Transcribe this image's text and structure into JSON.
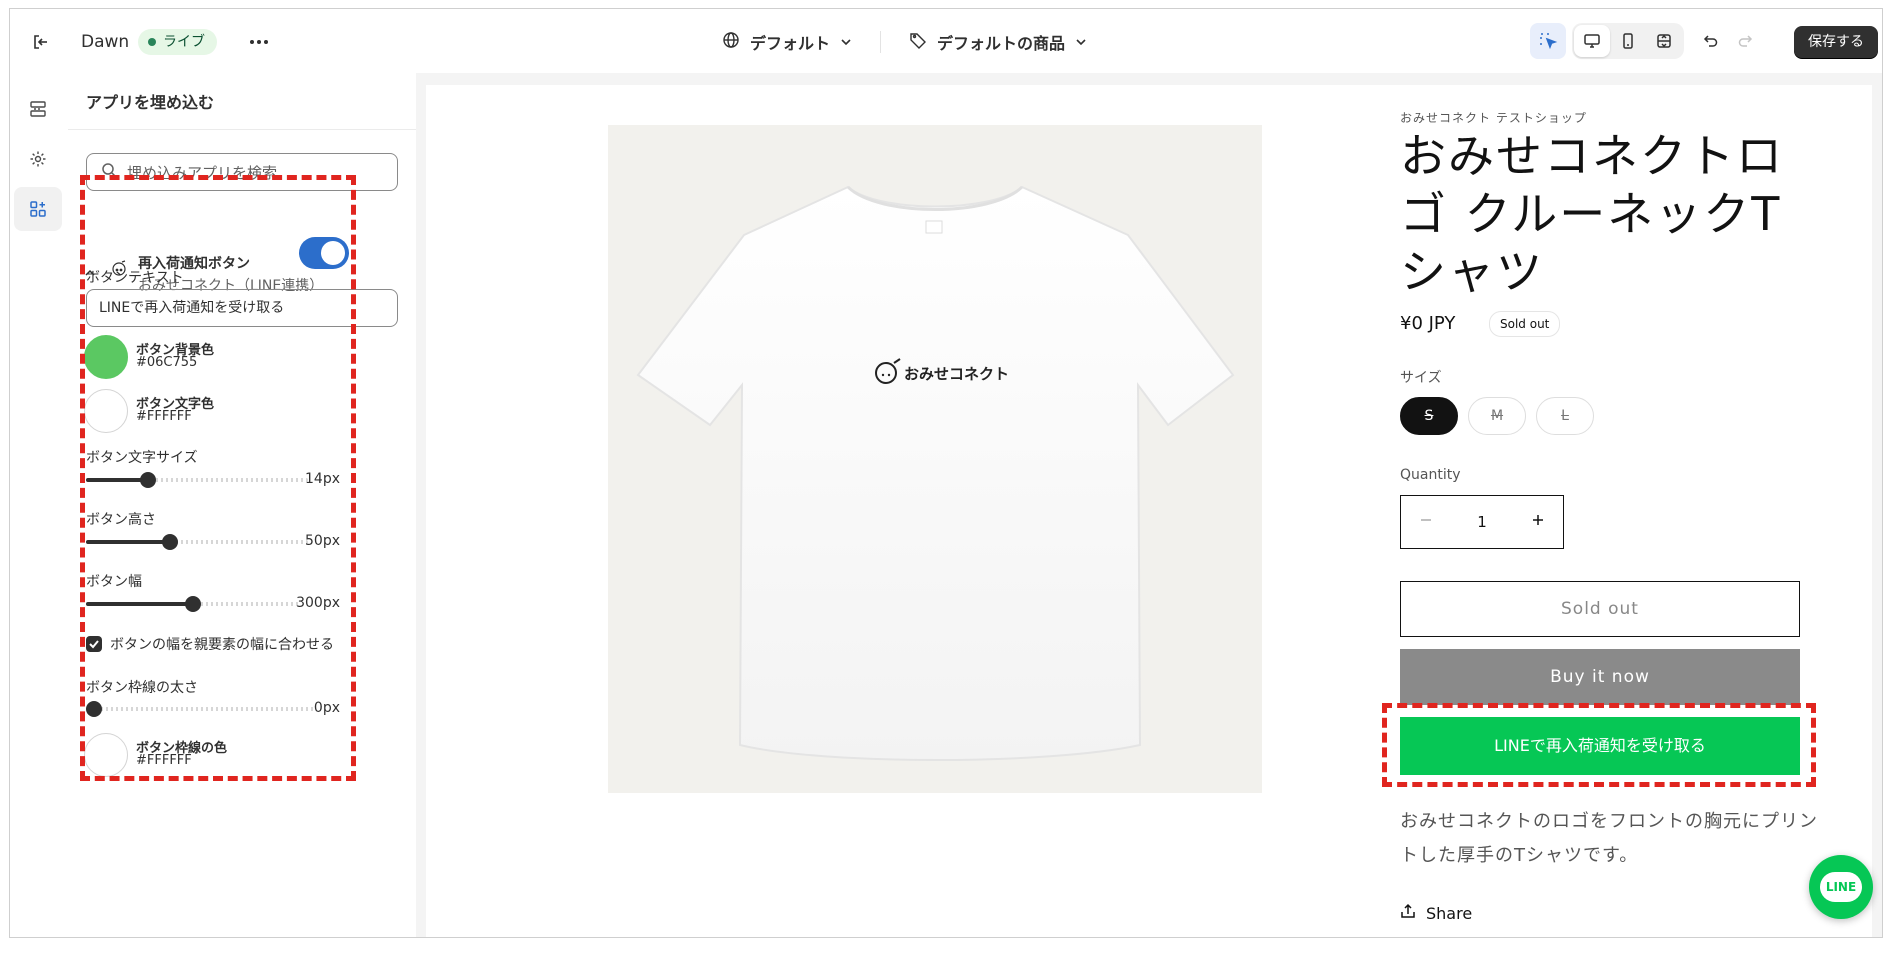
{
  "topbar": {
    "theme_name": "Dawn",
    "status_badge": "ライブ",
    "template_selector": "デフォルト",
    "product_selector": "デフォルトの商品",
    "save_label": "保存する"
  },
  "panel": {
    "title": "アプリを埋め込む",
    "search_placeholder": "埋め込みアプリを検索",
    "app": {
      "name": "再入荷通知ボタン",
      "provider": "おみせコネクト（LINE連携）",
      "enabled": true
    },
    "button_text_label": "ボタンテキスト",
    "button_text_value": "LINEで再入荷通知を受け取る",
    "bg_color": {
      "label": "ボタン背景色",
      "value": "#06C755"
    },
    "text_color": {
      "label": "ボタン文字色",
      "value": "#FFFFFF"
    },
    "font_size": {
      "label": "ボタン文字サイズ",
      "value": "14px",
      "level": 0.28
    },
    "height": {
      "label": "ボタン高さ",
      "value": "50px",
      "level": 0.38
    },
    "width": {
      "label": "ボタン幅",
      "value": "300px",
      "level": 0.5
    },
    "fit_parent_label": "ボタンの幅を親要素の幅に合わせる",
    "fit_parent_checked": true,
    "border_width": {
      "label": "ボタン枠線の太さ",
      "value": "0px",
      "level": 0
    },
    "border_color": {
      "label": "ボタン枠線の色",
      "value": "#FFFFFF"
    }
  },
  "product": {
    "vendor": "おみせコネクト テストショップ",
    "title": "おみせコネクトロゴ クルーネックTシャツ",
    "image_logo_text": "おみせコネクト",
    "price": "¥0 JPY",
    "sold_out_badge": "Sold out",
    "size_label": "サイズ",
    "sizes": [
      "S",
      "M",
      "L"
    ],
    "quantity_label": "Quantity",
    "quantity": "1",
    "sold_out_button": "Sold out",
    "buy_now_button": "Buy it now",
    "line_button": "LINEで再入荷通知を受け取る",
    "description": "おみせコネクトのロゴをフロントの胸元にプリントした厚手のTシャツです。",
    "share_label": "Share",
    "line_fab_label": "LINE"
  },
  "colors": {
    "accent_blue": "#2c6ecb",
    "line_green": "#06c755",
    "highlight_red": "#e0251f"
  }
}
